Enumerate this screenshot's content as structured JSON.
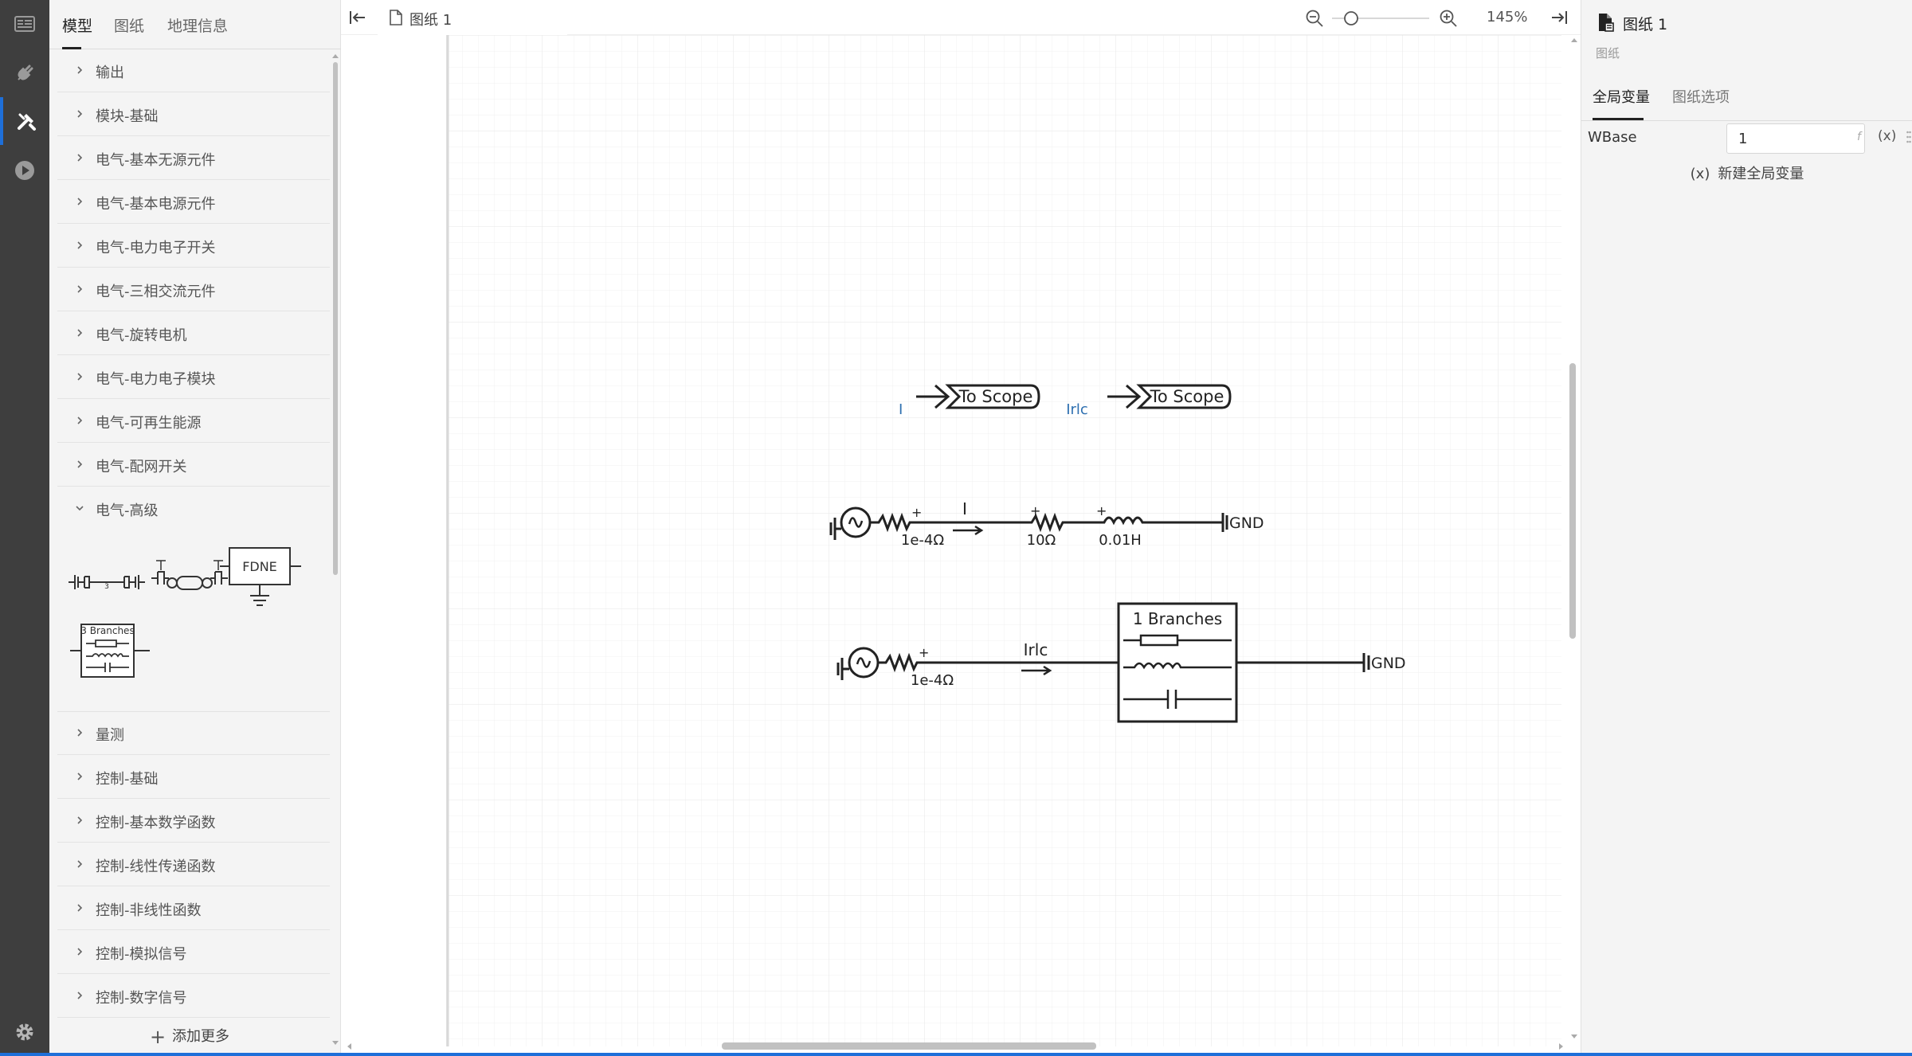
{
  "activity_bar": {
    "items": [
      {
        "icon": "layout-icon",
        "active": false
      },
      {
        "icon": "plug-icon",
        "active": false
      },
      {
        "icon": "tools-icon",
        "active": true
      },
      {
        "icon": "play-icon",
        "active": false
      }
    ],
    "bottom_icon": "gear-icon"
  },
  "left_panel": {
    "tabs": [
      {
        "label": "模型",
        "active": true
      },
      {
        "label": "图纸",
        "active": false
      },
      {
        "label": "地理信息",
        "active": false
      }
    ],
    "categories": [
      {
        "label": "输出",
        "expanded": false
      },
      {
        "label": "模块-基础",
        "expanded": false
      },
      {
        "label": "电气-基本无源元件",
        "expanded": false
      },
      {
        "label": "电气-基本电源元件",
        "expanded": false
      },
      {
        "label": "电气-电力电子开关",
        "expanded": false
      },
      {
        "label": "电气-三相交流元件",
        "expanded": false
      },
      {
        "label": "电气-旋转电机",
        "expanded": false
      },
      {
        "label": "电气-电力电子模块",
        "expanded": false
      },
      {
        "label": "电气-可再生能源",
        "expanded": false
      },
      {
        "label": "电气-配网开关",
        "expanded": false
      },
      {
        "label": "电气-高级",
        "expanded": true
      }
    ],
    "expanded_components": {
      "fdne_label": "FDNE",
      "branches_label": "3 Branches",
      "line_number": "3"
    },
    "categories_after": [
      {
        "label": "量测",
        "expanded": false
      },
      {
        "label": "控制-基础",
        "expanded": false
      },
      {
        "label": "控制-基本数学函数",
        "expanded": false
      },
      {
        "label": "控制-线性传递函数",
        "expanded": false
      },
      {
        "label": "控制-非线性函数",
        "expanded": false
      },
      {
        "label": "控制-模拟信号",
        "expanded": false
      },
      {
        "label": "控制-数字信号",
        "expanded": false
      }
    ],
    "add_more_label": "添加更多"
  },
  "canvas": {
    "tab_title": "图纸 1",
    "zoom_level": "145%",
    "scope_blocks": [
      {
        "signal": "I",
        "label": "To Scope"
      },
      {
        "signal": "Irlc",
        "label": "To Scope"
      }
    ],
    "circuit1": {
      "source_resistance": "1e-4Ω",
      "current_label": "I",
      "resistor": "10Ω",
      "inductor": "0.01H",
      "ground": "GND"
    },
    "circuit2": {
      "source_resistance": "1e-4Ω",
      "current_label": "Irlc",
      "branch_label": "1 Branches",
      "ground": "GND"
    },
    "plus_sign": "+"
  },
  "right_panel": {
    "title": "图纸 1",
    "subtitle": "图纸",
    "tabs": [
      {
        "label": "全局变量",
        "active": true
      },
      {
        "label": "图纸选项",
        "active": false
      }
    ],
    "variables": [
      {
        "name": "WBase",
        "value": "1",
        "type_mark": "f",
        "expr_mark": "(x)"
      }
    ],
    "new_var_icon": "(x)",
    "new_var_label": "新建全局变量"
  },
  "colors": {
    "accent": "#1e6fd9",
    "signal_label": "#2d6fb0",
    "activity_bg": "#3e3e3e"
  }
}
